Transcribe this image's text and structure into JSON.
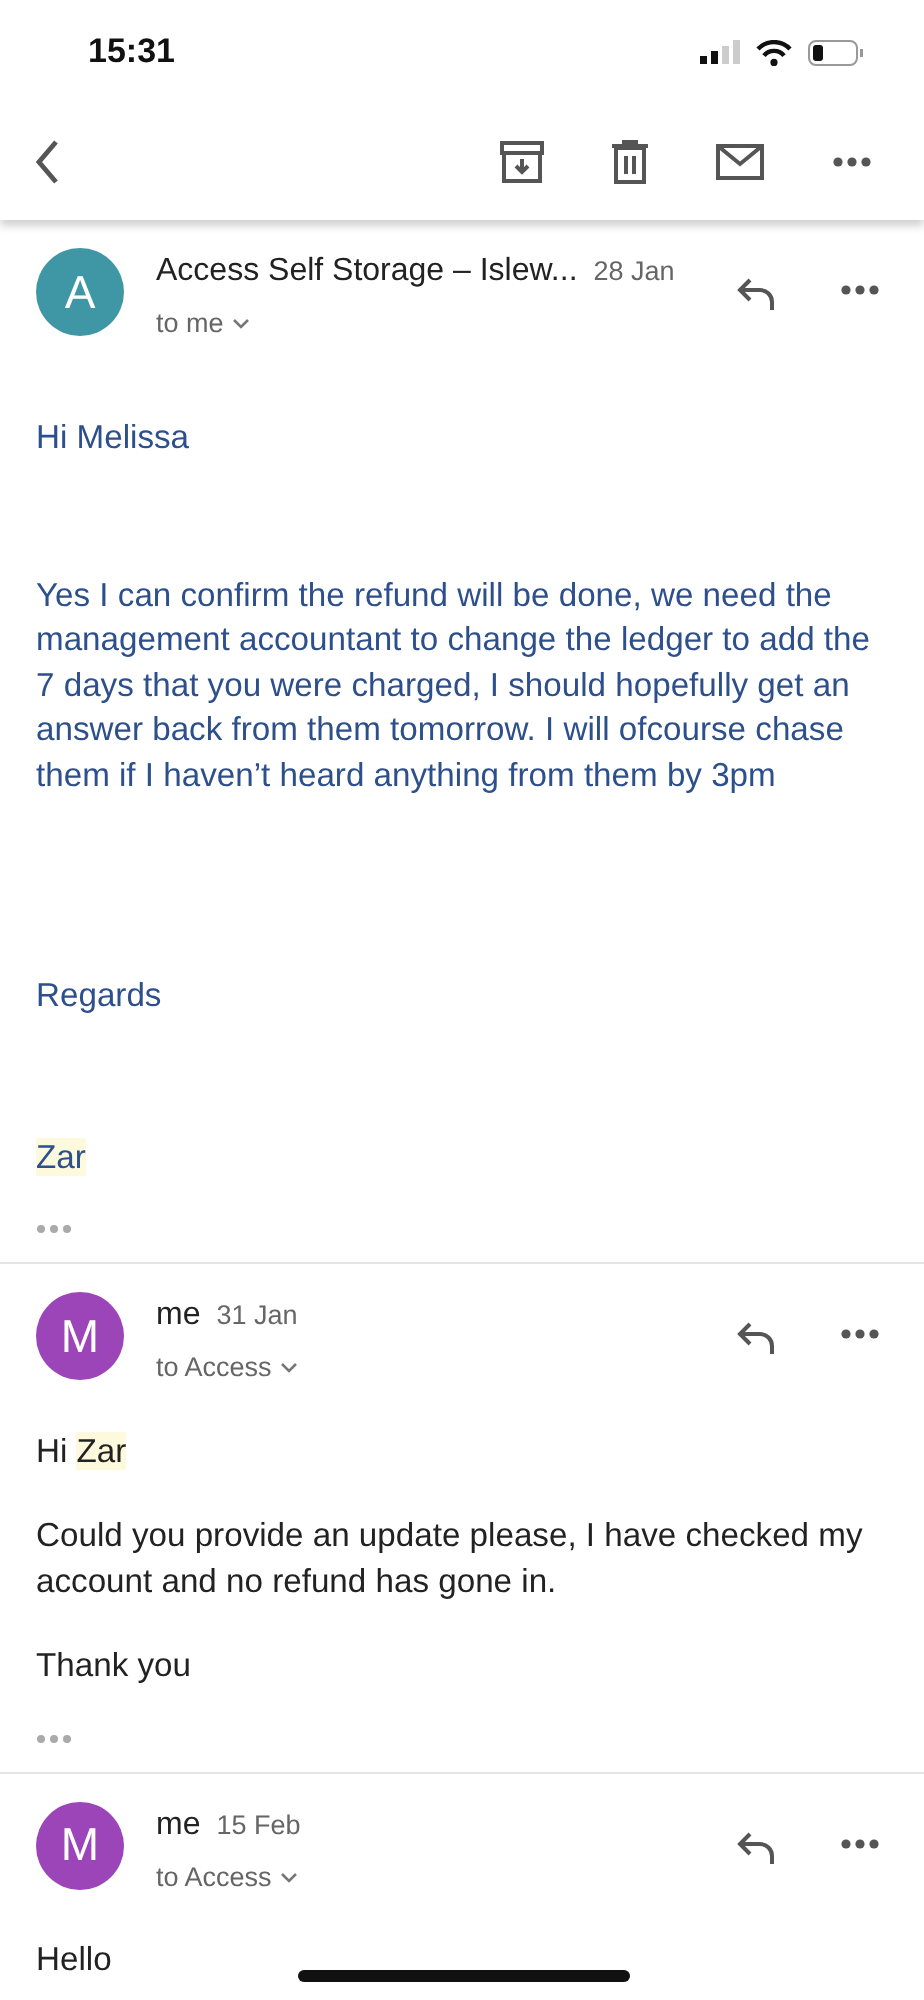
{
  "status_bar": {
    "time": "15:31"
  },
  "messages": [
    {
      "avatar": "A",
      "color": "#3f97a5",
      "sender": "Access Self Storage – Islew...",
      "date": "28 Jan",
      "recipient": "to me",
      "kind": "formatted",
      "paragraphs": [
        [
          {
            "text": "Hi Melissa",
            "highlighted": false
          }
        ],
        [
          {
            "text": "Yes I can confirm the refund will be done, we need the management accountant to change the ledger to add the 7 days that you were charged, I should hopefully get an answer back from them tomorrow. I will ofcourse chase them if I haven’t heard anything from them by 3pm",
            "highlighted": false
          }
        ],
        [
          {
            "text": "Regards",
            "highlighted": false
          }
        ],
        [
          {
            "text": "Zar",
            "highlighted": true
          }
        ]
      ],
      "trimmed": true
    },
    {
      "avatar": "M",
      "color": "#9b45b8",
      "sender": "me",
      "date": "31 Jan",
      "recipient": "to Access",
      "kind": "plain",
      "paragraphs": [
        [
          {
            "text": "Hi ",
            "highlighted": false
          },
          {
            "text": "Zar",
            "highlighted": true
          }
        ],
        [
          {
            "text": "Could you provide an update please, I have checked my account and no refund has gone in.",
            "highlighted": false
          }
        ],
        [
          {
            "text": "Thank you",
            "highlighted": false
          }
        ]
      ],
      "trimmed": true
    },
    {
      "avatar": "M",
      "color": "#9b45b8",
      "sender": "me",
      "date": "15 Feb",
      "recipient": "to Access",
      "kind": "plain",
      "paragraphs": [
        [
          {
            "text": "Hello",
            "highlighted": false
          }
        ]
      ],
      "trimmed": false
    }
  ]
}
